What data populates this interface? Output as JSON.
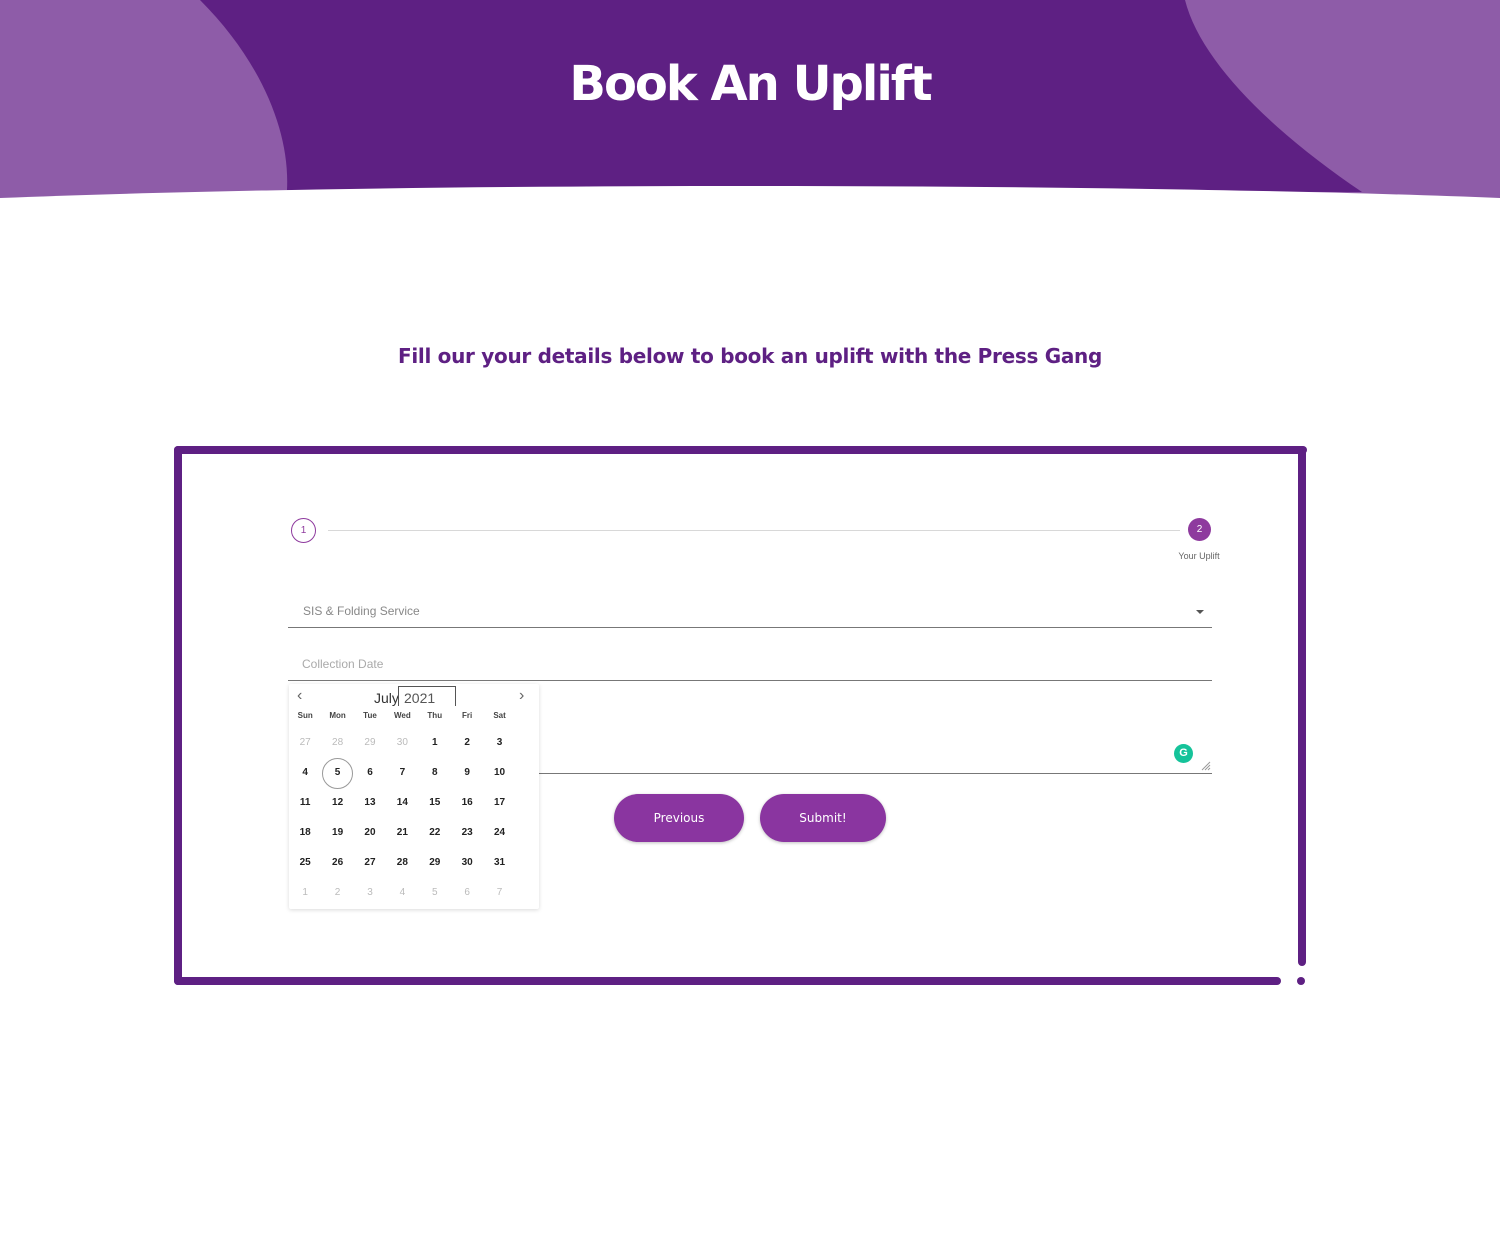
{
  "header": {
    "title": "Book An Uplift",
    "colors": {
      "primary": "#5e2083",
      "light": "#8e5ca8"
    }
  },
  "subtitle": "Fill our your details below to book an uplift with the Press Gang",
  "stepper": {
    "steps": [
      {
        "number": "1",
        "label": "",
        "active": false
      },
      {
        "number": "2",
        "label": "Your Uplift",
        "active": true
      }
    ]
  },
  "form": {
    "service_select": {
      "value": "SIS & Folding Service"
    },
    "collection_date": {
      "placeholder": "Collection Date",
      "value": ""
    },
    "notes": {
      "value": ""
    },
    "buttons": {
      "previous": "Previous",
      "submit": "Submit!"
    }
  },
  "datepicker": {
    "month": "July",
    "year": "2021",
    "prev_icon": "‹",
    "next_icon": "›",
    "weekdays": [
      "Sun",
      "Mon",
      "Tue",
      "Wed",
      "Thu",
      "Fri",
      "Sat"
    ],
    "weeks": [
      [
        {
          "d": "27",
          "m": true
        },
        {
          "d": "28",
          "m": true
        },
        {
          "d": "29",
          "m": true
        },
        {
          "d": "30",
          "m": true
        },
        {
          "d": "1"
        },
        {
          "d": "2"
        },
        {
          "d": "3"
        }
      ],
      [
        {
          "d": "4"
        },
        {
          "d": "5",
          "today": true
        },
        {
          "d": "6"
        },
        {
          "d": "7"
        },
        {
          "d": "8"
        },
        {
          "d": "9"
        },
        {
          "d": "10"
        }
      ],
      [
        {
          "d": "11"
        },
        {
          "d": "12"
        },
        {
          "d": "13"
        },
        {
          "d": "14"
        },
        {
          "d": "15"
        },
        {
          "d": "16"
        },
        {
          "d": "17"
        }
      ],
      [
        {
          "d": "18"
        },
        {
          "d": "19"
        },
        {
          "d": "20"
        },
        {
          "d": "21"
        },
        {
          "d": "22"
        },
        {
          "d": "23"
        },
        {
          "d": "24"
        }
      ],
      [
        {
          "d": "25"
        },
        {
          "d": "26"
        },
        {
          "d": "27"
        },
        {
          "d": "28"
        },
        {
          "d": "29"
        },
        {
          "d": "30"
        },
        {
          "d": "31"
        }
      ],
      [
        {
          "d": "1",
          "m": true
        },
        {
          "d": "2",
          "m": true
        },
        {
          "d": "3",
          "m": true
        },
        {
          "d": "4",
          "m": true
        },
        {
          "d": "5",
          "m": true
        },
        {
          "d": "6",
          "m": true
        },
        {
          "d": "7",
          "m": true
        }
      ]
    ]
  },
  "grammarly_icon": "G"
}
